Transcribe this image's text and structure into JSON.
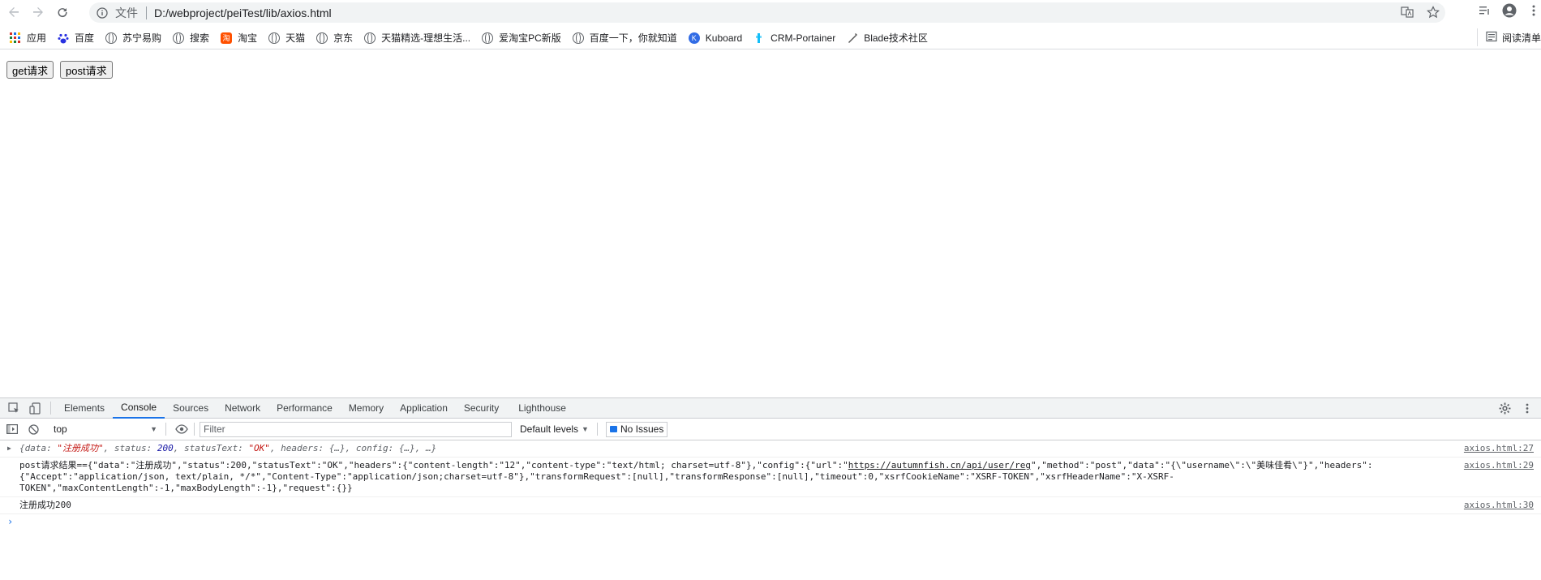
{
  "toolbar": {
    "scheme": "文件",
    "url": "D:/webproject/peiTest/lib/axios.html"
  },
  "bookmarks": [
    {
      "label": "应用",
      "icon": "apps-grid-icon"
    },
    {
      "label": "百度",
      "icon": "baidu-paw-icon"
    },
    {
      "label": "苏宁易购",
      "icon": "globe-icon"
    },
    {
      "label": "搜索",
      "icon": "globe-icon"
    },
    {
      "label": "淘宝",
      "icon": "taobao-icon"
    },
    {
      "label": "天猫",
      "icon": "globe-icon"
    },
    {
      "label": "京东",
      "icon": "globe-icon"
    },
    {
      "label": "天猫精选-理想生活...",
      "icon": "globe-icon"
    },
    {
      "label": "爱淘宝PC新版",
      "icon": "globe-icon"
    },
    {
      "label": "百度一下，你就知道",
      "icon": "globe-icon"
    },
    {
      "label": "Kuboard",
      "icon": "kuboard-icon"
    },
    {
      "label": "CRM-Portainer",
      "icon": "portainer-icon"
    },
    {
      "label": "Blade技术社区",
      "icon": "blade-icon"
    }
  ],
  "reading_list": "阅读清单",
  "page": {
    "get_button": "get请求",
    "post_button": "post请求"
  },
  "devtools": {
    "tabs": [
      "Elements",
      "Console",
      "Sources",
      "Network",
      "Performance",
      "Memory",
      "Application",
      "Security",
      "Lighthouse"
    ],
    "active_tab": "Console",
    "context": "top",
    "filter_placeholder": "Filter",
    "levels": "Default levels",
    "issues": "No Issues"
  },
  "console": {
    "log1": {
      "k_data": "{data: ",
      "v_data": "\"注册成功\"",
      "k_status": ", status: ",
      "v_status": "200",
      "k_statusText": ", statusText: ",
      "v_statusText": "\"OK\"",
      "rest": ", headers: {…}, config: {…}, …}",
      "source": "axios.html:27"
    },
    "log2": {
      "line1a": "post请求结果=={\"data\":\"注册成功\",\"status\":200,\"statusText\":\"OK\",\"headers\":{\"content-length\":\"12\",\"content-type\":\"text/html; charset=utf-8\"},\"config\":{\"url\":\"",
      "link": "https://autumnfish.cn/api/user/reg",
      "line1b": "\",\"method\":\"post\",\"data\":\"{\\\"username\\\":\\\"美味佳肴\\\"}\",\"headers\":",
      "line2": "{\"Accept\":\"application/json, text/plain, */*\",\"Content-Type\":\"application/json;charset=utf-8\"},\"transformRequest\":[null],\"transformResponse\":[null],\"timeout\":0,\"xsrfCookieName\":\"XSRF-TOKEN\",\"xsrfHeaderName\":\"X-XSRF-TOKEN\",\"maxContentLength\":-1,\"maxBodyLength\":-1},\"request\":{}}",
      "source": "axios.html:29"
    },
    "log3": {
      "text": "注册成功200",
      "source": "axios.html:30"
    },
    "prompt": "›"
  }
}
